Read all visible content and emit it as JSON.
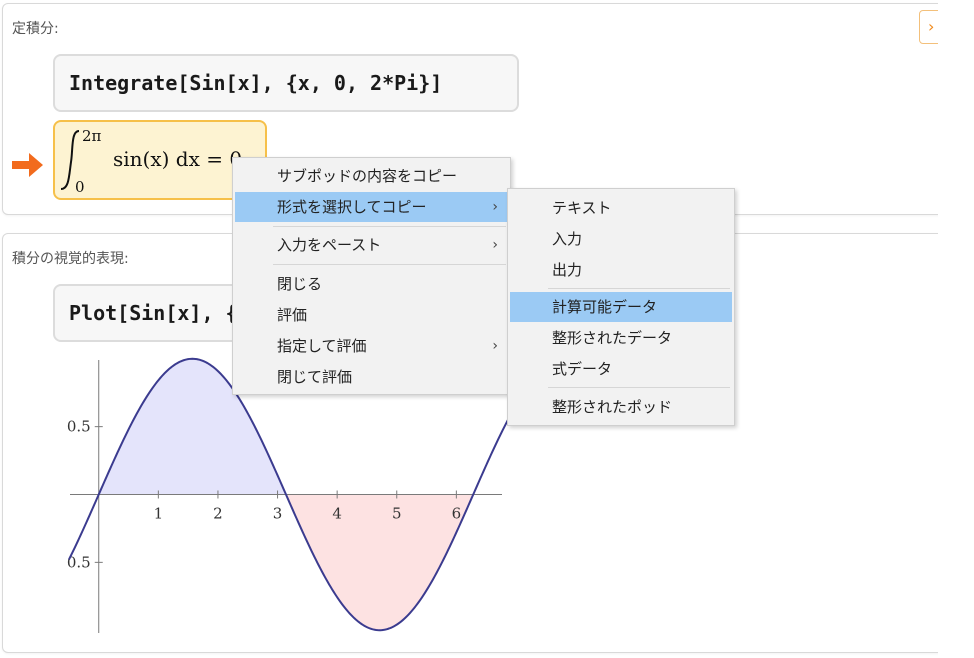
{
  "pod1": {
    "title": "定積分:",
    "input": "Integrate[Sin[x], {x, 0, 2*Pi}]",
    "output": {
      "upper_limit": "2π",
      "lower_limit": "0",
      "integrand": "sin(x) dx = 0"
    }
  },
  "pod2": {
    "title": "積分の視覚的表現:",
    "input": "Plot[Sin[x], {x, 0, 2*Pi}, Filling -> Axis]"
  },
  "chart_data": {
    "type": "line",
    "function": "sin(x)",
    "x_range": [
      -0.65,
      6.9
    ],
    "ylim": [
      -1.05,
      1.05
    ],
    "x_ticks": [
      1,
      2,
      3,
      4,
      5,
      6
    ],
    "x_tick_labels": [
      "1",
      "2",
      "3",
      "4",
      "5",
      "6"
    ],
    "y_ticks": [
      0.5,
      -0.5
    ],
    "y_tick_labels": [
      "0.5",
      "0.5"
    ],
    "fill": {
      "positive_color": "#e4e4fb",
      "negative_color": "#fde2e2",
      "range": [
        0,
        6.2832
      ]
    },
    "line_color": "#3b3b8f"
  },
  "context_menu": {
    "items": [
      {
        "label": "サブポッドの内容をコピー",
        "has_submenu": false
      },
      {
        "label": "形式を選択してコピー",
        "has_submenu": true,
        "active": true
      },
      {
        "label": "入力をペースト",
        "has_submenu": true
      },
      {
        "label": "閉じる",
        "has_submenu": false
      },
      {
        "label": "評価",
        "has_submenu": false
      },
      {
        "label": "指定して評価",
        "has_submenu": true
      },
      {
        "label": "閉じて評価",
        "has_submenu": false
      }
    ],
    "chevron": "›"
  },
  "submenu": {
    "items": [
      {
        "label": "テキスト"
      },
      {
        "label": "入力"
      },
      {
        "label": "出力"
      },
      {
        "label": "計算可能データ",
        "active": true
      },
      {
        "label": "整形されたデータ"
      },
      {
        "label": "式データ"
      },
      {
        "label": "整形されたポッド"
      }
    ]
  },
  "colors": {
    "accent_orange": "#f26b1d",
    "output_bg": "#fdf3d2",
    "output_border": "#f6c04a",
    "menu_highlight": "#9bcaf4"
  }
}
